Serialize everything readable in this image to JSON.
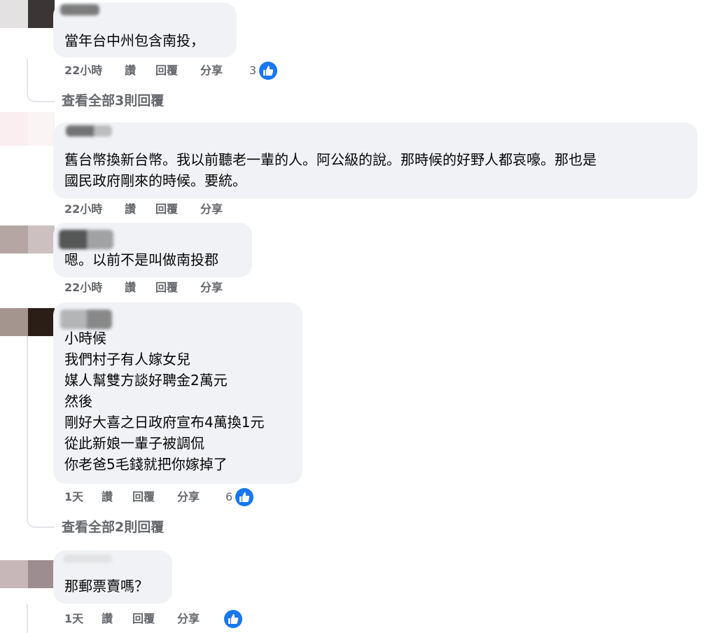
{
  "comments": [
    {
      "text": "當年台中州包含南投，",
      "time": "22小時",
      "like_label": "讚",
      "reply_label": "回覆",
      "share_label": "分享",
      "reaction_count": "3"
    },
    {
      "view_replies": "查看全部3則回覆"
    },
    {
      "lines": [
        "舊台幣換新台幣。我以前聽老一輩的人。阿公級的說。那時候的好野人都哀嚎。那也是",
        "國民政府剛來的時候。要統。"
      ],
      "time": "22小時",
      "like_label": "讚",
      "reply_label": "回覆",
      "share_label": "分享"
    },
    {
      "text": "嗯。以前不是叫做南投郡",
      "time": "22小時",
      "like_label": "讚",
      "reply_label": "回覆",
      "share_label": "分享"
    },
    {
      "lines": [
        "小時候",
        "我們村子有人嫁女兒",
        "媒人幫雙方談好聘金2萬元",
        "然後",
        "剛好大喜之日政府宣布4萬換1元",
        "從此新娘一輩子被調侃",
        "你老爸5毛錢就把你嫁掉了"
      ],
      "time": "1天",
      "like_label": "讚",
      "reply_label": "回覆",
      "share_label": "分享",
      "reaction_count": "6"
    },
    {
      "view_replies": "查看全部2則回覆"
    },
    {
      "text": "那郵票賣嗎？",
      "time": "1天",
      "like_label": "讚",
      "reply_label": "回覆",
      "share_label": "分享"
    }
  ],
  "icons": {
    "reaction": "like-thumbs-up-icon"
  },
  "colors": {
    "bubble": "#f0f2f5",
    "meta_text": "#65676b",
    "like_blue": "#1877f2"
  }
}
